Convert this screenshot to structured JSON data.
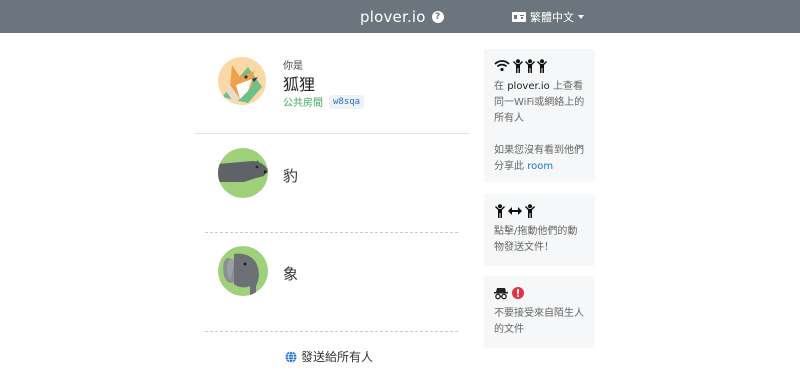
{
  "header": {
    "brand": "plover.io",
    "help_icon": "question-circle-icon",
    "language": "繁體中文",
    "language_icon": "language-icon"
  },
  "self": {
    "you_are": "你是",
    "name": "狐狸",
    "room_label": "公共房間",
    "room_code": "w8sqa",
    "avatar": "fox-avatar"
  },
  "peers": [
    {
      "name": "豹",
      "avatar": "leopard-avatar"
    },
    {
      "name": "象",
      "avatar": "elephant-avatar"
    }
  ],
  "send_all": {
    "label": "發送給所有人",
    "icon": "globe-icon"
  },
  "sidebar": {
    "card1": {
      "icons": [
        "wifi-icon",
        "person-icon",
        "person-icon",
        "person-icon"
      ],
      "line1_prefix": "在 ",
      "line1_brand": "plover.io",
      "line1_suffix": " 上查看同一WiFi或網絡上的所有人",
      "line2_prefix": "如果您沒有看到他們分享此 ",
      "line2_link": "room"
    },
    "card2": {
      "icons": [
        "person-icon",
        "arrows-left-right-icon",
        "person-icon"
      ],
      "text": "點擊/拖動他們的動物發送文件！"
    },
    "card3": {
      "icons": [
        "incognito-icon",
        "exclamation-circle-icon"
      ],
      "text": "不要接受來自陌生人的文件"
    }
  },
  "colors": {
    "header_bg": "#6c757d",
    "accent_green": "#3cab5a",
    "link_blue": "#1f6fd6",
    "card_bg": "#f6f7f8"
  }
}
